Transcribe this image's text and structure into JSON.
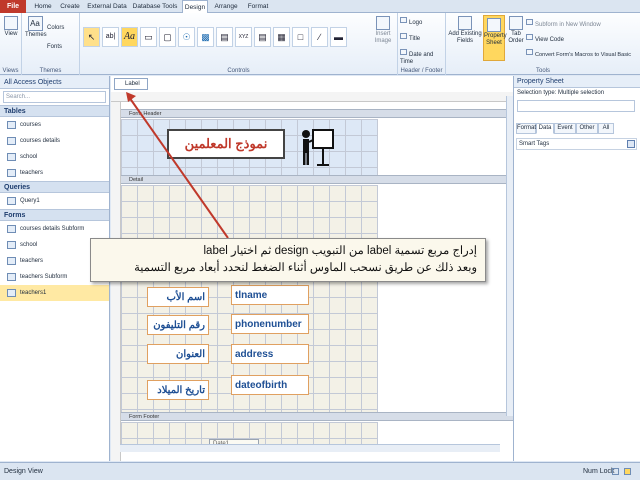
{
  "ribbon_tabs": {
    "file": "File",
    "home": "Home",
    "create": "Create",
    "external_data": "External Data",
    "database_tools": "Database Tools",
    "design": "Design",
    "arrange": "Arrange",
    "format": "Format"
  },
  "views_group": {
    "view_label": "View",
    "group_label": "Views"
  },
  "themes_group": {
    "themes_label": "Themes",
    "colors_label": "Colors",
    "fonts_label": "Fonts",
    "group_label": "Themes"
  },
  "controls_group": {
    "group_label": "Controls",
    "insert_image_label": "Insert Image",
    "textbox_glyph": "ab|",
    "label_glyph": "Aa",
    "xyz_glyph": "XYZ"
  },
  "header_footer_group": {
    "logo_label": "Logo",
    "title_label": "Title",
    "date_time_label": "Date and Time",
    "group_label": "Header / Footer"
  },
  "tools_group": {
    "add_fields_label": "Add Existing Fields",
    "property_sheet_label": "Property Sheet",
    "tab_order_label": "Tab Order",
    "subform_label": "Subform in New Window",
    "view_code_label": "View Code",
    "convert_macros_label": "Convert Form's Macros to Visual Basic",
    "group_label": "Tools"
  },
  "nav_pane": {
    "title": "All Access Objects",
    "search_placeholder": "Search...",
    "sections": [
      {
        "name": "Tables",
        "items": [
          "courses",
          "courses details",
          "school",
          "teachers"
        ]
      },
      {
        "name": "Queries",
        "items": [
          "Query1"
        ]
      },
      {
        "name": "Forms",
        "items": [
          "courses details Subform",
          "school",
          "teachers",
          "teachers Subform",
          "teachers1"
        ]
      }
    ]
  },
  "document": {
    "tab_label": "Label",
    "form_header_label": "Form Header",
    "detail_label": "Detail",
    "form_footer_label": "Form Footer",
    "title_label": "نموذج المعلمين",
    "footer_field": "Date1",
    "fields": [
      {
        "label": "اسم الأب",
        "control": "tlname"
      },
      {
        "label": "رقم التليفون",
        "control": "phonenumber"
      },
      {
        "label": "العنوان",
        "control": "address"
      },
      {
        "label": "تاريخ الميلاد",
        "control": "dateofbirth"
      }
    ]
  },
  "property_sheet": {
    "title": "Property Sheet",
    "selection_type": "Selection type:  Multiple selection",
    "tabs": [
      "Format",
      "Data",
      "Event",
      "Other",
      "All"
    ],
    "active_tab": "Data",
    "row_label": "Smart Tags"
  },
  "callout": {
    "line1": "إدراج مربع تسمية label من التبويب design ثم اختيار label",
    "line2": "وبعد ذلك عن طريق نسحب الماوس أثناء الضغط لنحدد أبعاد مربع التسمية"
  },
  "status_bar": {
    "left": "Design View",
    "num_lock": "Num Lock"
  },
  "colors": {
    "file_tab": "#c0392b",
    "title_text": "#c0392b",
    "label_text": "#1e4f94",
    "arrow": "#c0392b"
  }
}
